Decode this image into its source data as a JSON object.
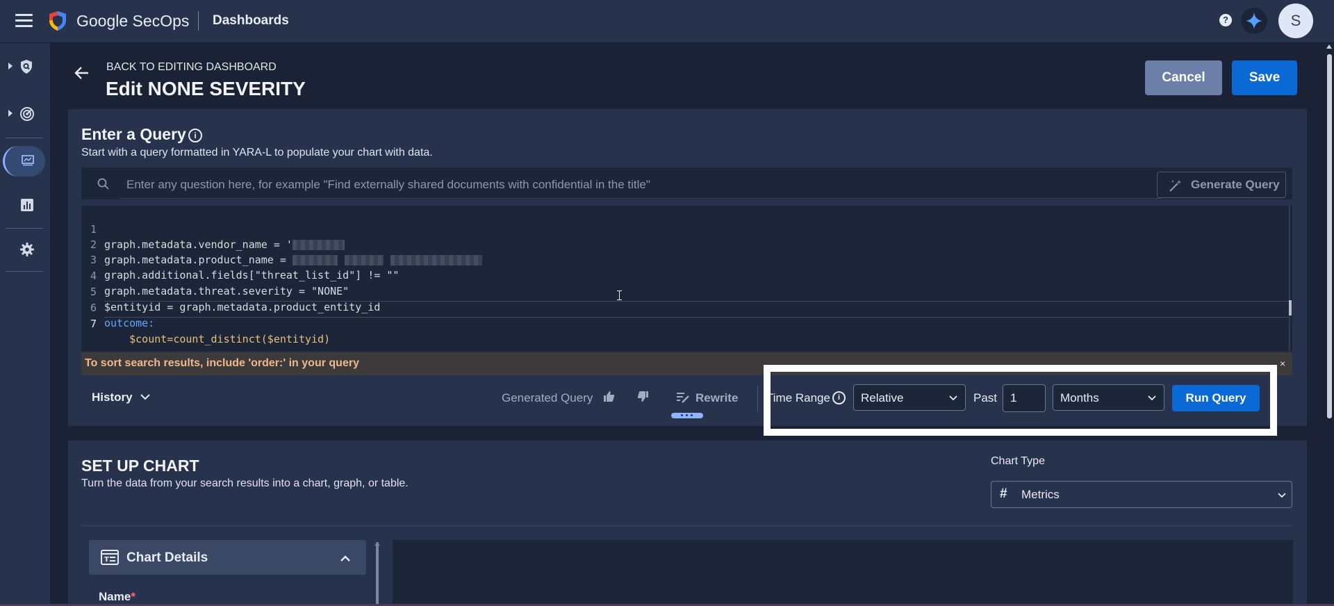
{
  "header": {
    "brand": "Google SecOps",
    "section": "Dashboards",
    "help": "?",
    "avatar_initial": "S"
  },
  "page": {
    "back_label": "BACK TO EDITING DASHBOARD",
    "title": "Edit NONE SEVERITY",
    "cancel_label": "Cancel",
    "save_label": "Save"
  },
  "query": {
    "title": "Enter a Query",
    "info": "i",
    "subtitle": "Start with a query formatted in YARA-L to populate your chart with data.",
    "nl_placeholder": "Enter any question here, for example \"Find externally shared documents with confidential in the title\"",
    "generate_label": "Generate Query",
    "lines": [
      {
        "n": "1",
        "text": "graph.metadata.vendor_name = '"
      },
      {
        "n": "2",
        "text": "graph.metadata.product_name = "
      },
      {
        "n": "3",
        "text": "graph.additional.fields[\"threat_list_id\"] != \"\""
      },
      {
        "n": "4",
        "text": "graph.metadata.threat.severity = \"NONE\""
      },
      {
        "n": "5",
        "text": "$entityid = graph.metadata.product_entity_id"
      },
      {
        "n": "6",
        "text": "outcome:"
      },
      {
        "n": "7",
        "text": "    $count=count_distinct($entityid)"
      }
    ],
    "warning": "To sort search results, include 'order:' in your query",
    "close": "×"
  },
  "toolbar": {
    "history_label": "History",
    "generated_label": "Generated Query",
    "rewrite_label": "Rewrite",
    "time_range_label": "Time Range",
    "time_range_info": "i",
    "time_mode": "Relative",
    "past_label": "Past",
    "past_value": "1",
    "unit": "Months",
    "run_label": "Run Query"
  },
  "chart": {
    "title": "SET UP CHART",
    "subtitle": "Turn the data from your search results into a chart, graph, or table.",
    "type_label": "Chart Type",
    "type_icon": "#",
    "type_value": "Metrics",
    "details_title": "Chart Details",
    "name_label": "Name",
    "name_required": "*"
  },
  "colors": {
    "primary_button": "#0b69d6",
    "highlight_box": "#ffffff",
    "warning_text": "#f2b78b"
  }
}
